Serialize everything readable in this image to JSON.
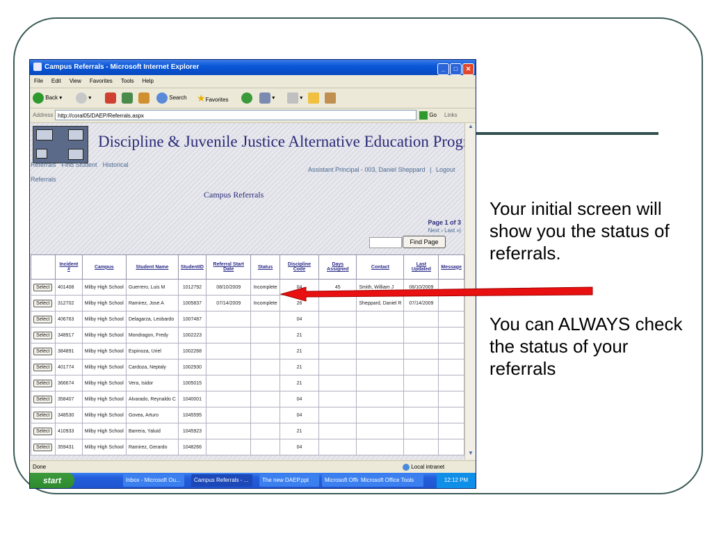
{
  "slide": {
    "text1": "Your initial screen will show you the status of referrals.",
    "text2": "You can ALWAYS check the status of your referrals"
  },
  "window": {
    "title": "Campus Referrals - Microsoft Internet Explorer",
    "menu": [
      "File",
      "Edit",
      "View",
      "Favorites",
      "Tools",
      "Help"
    ],
    "back_label": "Back",
    "search_label": "Search",
    "favorites_label": "Favorites",
    "address_label": "Address",
    "address_value": "http://coral05/DAEP/Referrals.aspx",
    "go_label": "Go",
    "links_label": "Links"
  },
  "app": {
    "banner_title": "Discipline & Juvenile Justice Alternative Education Program",
    "nav": [
      "Referrals",
      "Find Student",
      "Historical"
    ],
    "nav2": "Referrals",
    "user_text": "Assistant Principal - 003, Daniel Sheppard",
    "logout_label": "Logout",
    "separator": "|",
    "page_title": "Campus Referrals",
    "page_info": "Page 1 of 3",
    "page_nav": "Next › Last »|",
    "find_page_label": "Find Page",
    "select_label": "Select"
  },
  "table": {
    "headers": [
      "Incident #",
      "Campus",
      "Student Name",
      "StudentID",
      "Referral Start Date",
      "Status",
      "Discipline Code",
      "Days Assigned",
      "Contact",
      "Last Updated",
      "Message"
    ],
    "rows": [
      [
        "401408",
        "Milby High School",
        "Guerrero, Luis M",
        "1012792",
        "08/10/2009",
        "Incomplete",
        "04",
        "45",
        "Smith, William J",
        "08/10/2009",
        ""
      ],
      [
        "312702",
        "Milby High School",
        "Ramirez, Jose A",
        "1005837",
        "07/14/2009",
        "Incomplete",
        "26",
        "",
        "Sheppard, Daniel R",
        "07/14/2009",
        ""
      ],
      [
        "406763",
        "Milby High School",
        "Delagarza, Leobardo",
        "1007487",
        "",
        "",
        "04",
        "",
        "",
        "",
        ""
      ],
      [
        "348917",
        "Milby High School",
        "Mondragon, Fredy",
        "1002223",
        "",
        "",
        "21",
        "",
        "",
        "",
        ""
      ],
      [
        "384891",
        "Milby High School",
        "Espinoza, Uriel",
        "1002268",
        "",
        "",
        "21",
        "",
        "",
        "",
        ""
      ],
      [
        "401774",
        "Milby High School",
        "Cardoza, Neptaly",
        "1002930",
        "",
        "",
        "21",
        "",
        "",
        "",
        ""
      ],
      [
        "366674",
        "Milby High School",
        "Vera, Isidor",
        "1005015",
        "",
        "",
        "21",
        "",
        "",
        "",
        ""
      ],
      [
        "358407",
        "Milby High School",
        "Alvarado, Reynaldo C",
        "1040001",
        "",
        "",
        "04",
        "",
        "",
        "",
        ""
      ],
      [
        "348530",
        "Milby High School",
        "Govea, Arturo",
        "1045595",
        "",
        "",
        "04",
        "",
        "",
        "",
        ""
      ],
      [
        "410933",
        "Milby High School",
        "Barrera, Yaluid",
        "1045923",
        "",
        "",
        "21",
        "",
        "",
        "",
        ""
      ],
      [
        "359431",
        "Milby High School",
        "Ramirez, Gerardo",
        "1048266",
        "",
        "",
        "04",
        "",
        "",
        "",
        ""
      ]
    ]
  },
  "statusbar": {
    "left": "Done",
    "right": "Local intranet"
  },
  "taskbar": {
    "start": "start",
    "tasks": [
      "Inbox - Microsoft Ou...",
      "Campus Referrals - ...",
      "The new DAEP.ppt",
      "Microsoft Office",
      "Microsoft Office Tools"
    ],
    "clock": "12:12 PM"
  },
  "colors": {
    "frame": "#3a5a57",
    "arrow": "#e81010",
    "banner_text": "#2a2a78"
  }
}
